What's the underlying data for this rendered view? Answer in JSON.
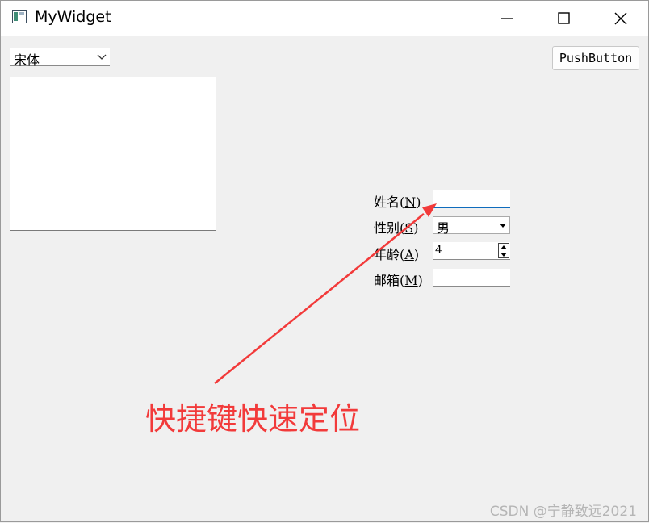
{
  "window": {
    "title": "MyWidget",
    "icon": "app-window-icon",
    "controls": [
      "minimize-icon",
      "maximize-icon",
      "close-icon"
    ]
  },
  "toolbar": {
    "font_combo_value": "宋体",
    "push_button_label": "PushButton"
  },
  "form": {
    "name": {
      "label": "姓名(",
      "mnemonic": "N",
      "label_end": ")",
      "value": ""
    },
    "gender": {
      "label": "性别(",
      "mnemonic": "S",
      "label_end": ")",
      "value": "男"
    },
    "age": {
      "label": "年龄(",
      "mnemonic": "A",
      "label_end": ")",
      "value": "4"
    },
    "email": {
      "label": "邮箱(",
      "mnemonic": "M",
      "label_end": ")",
      "value": ""
    }
  },
  "annotation": {
    "text": "快捷键快速定位",
    "color": "#f23a3a"
  },
  "watermark": "CSDN @宁静致远2021",
  "colors": {
    "focus_accent": "#0f6cbd",
    "window_bg": "#f0f0f0"
  }
}
